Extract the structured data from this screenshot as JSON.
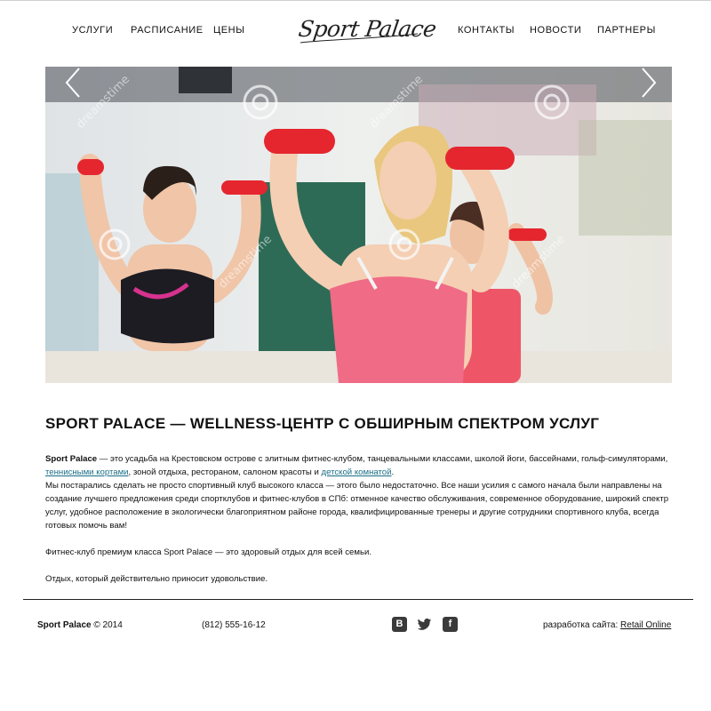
{
  "nav": {
    "left": [
      "УСЛУГИ",
      "РАСПИСАНИЕ",
      "ЦЕНЫ"
    ],
    "right": [
      "КОНТАКТЫ",
      "НОВОСТИ",
      "ПАРТНЕРЫ"
    ],
    "logo": "Sport Palace"
  },
  "hero": {
    "watermark": "dreamstime",
    "colors": {
      "dumbbell": "#e5262f",
      "top_pink": "#f06b86",
      "top_dark": "#1c1c22"
    }
  },
  "content": {
    "headline": "SPORT PALACE — WELLNESS-ЦЕНТР С ОБШИРНЫМ СПЕКТРОМ УСЛУГ",
    "p1_brand": "Sport Palace",
    "p1_text_a": " — это усадьба на Крестовском острове с элитным фитнес-клубом, танцевальными классами, школой йоги, бассейнами, гольф-симуляторами, ",
    "p1_link_1": "теннисными кортами",
    "p1_text_b": ", зоной отдыха, рестораном, салоном красоты и ",
    "p1_link_2": "детской комнатой",
    "p1_text_c": ".",
    "p2": "Мы постарались сделать не просто спортивный клуб высокого класса — этого было недостаточно. Все наши усилия с самого начала были направлены на создание лучшего предложения среди спортклубов и фитнес-клубов в СПб: отменное качество обслуживания, современное оборудование, широкий спектр услуг, удобное расположение в экологически благоприятном районе города, квалифицированные тренеры и другие сотрудники спортивного клуба, всегда готовых помочь вам!",
    "p3": "Фитнес-клуб премиум класса Sport Palace — это здоровый отдых для всей семьи.",
    "p4": "Отдых, который действительно приносит удовольствие."
  },
  "footer": {
    "brand": "Sport Palace",
    "copyright": " © 2014",
    "phone": "(812) 555-16-12",
    "social": {
      "vk": "В",
      "twitter": "🐦",
      "facebook": "f"
    },
    "dev_label": "разработка сайта: ",
    "dev_link": "Retail Online"
  }
}
